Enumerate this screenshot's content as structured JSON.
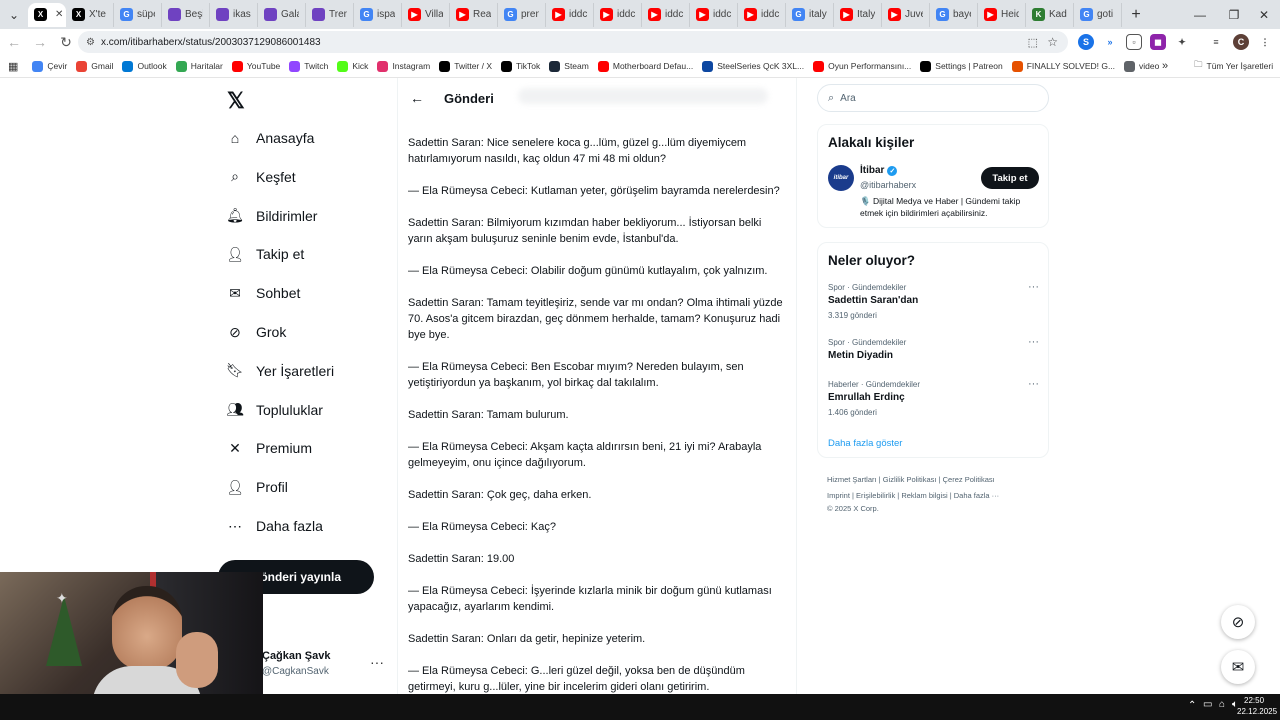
{
  "browser": {
    "tabs": [
      {
        "label": "X",
        "color": "#000000",
        "glyph": "X"
      },
      {
        "label": "X'te",
        "color": "#000000",
        "glyph": "X"
      },
      {
        "label": "süpe",
        "color": "#4285f4",
        "glyph": "G"
      },
      {
        "label": "Beşi",
        "color": "#6f42c1",
        "glyph": ""
      },
      {
        "label": "ikas",
        "color": "#6f42c1",
        "glyph": ""
      },
      {
        "label": "Gala",
        "color": "#6f42c1",
        "glyph": ""
      },
      {
        "label": "Trer",
        "color": "#6f42c1",
        "glyph": ""
      },
      {
        "label": "ispa",
        "color": "#4285f4",
        "glyph": "G"
      },
      {
        "label": "Villa",
        "color": "#ff0000",
        "glyph": "▶"
      },
      {
        "label": "Real",
        "color": "#ff0000",
        "glyph": "▶"
      },
      {
        "label": "pren",
        "color": "#4285f4",
        "glyph": "G"
      },
      {
        "label": "iddc",
        "color": "#ff0000",
        "glyph": "▶"
      },
      {
        "label": "iddc",
        "color": "#ff0000",
        "glyph": "▶"
      },
      {
        "label": "iddc",
        "color": "#ff0000",
        "glyph": "▶"
      },
      {
        "label": "iddc",
        "color": "#ff0000",
        "glyph": "▶"
      },
      {
        "label": "iddc",
        "color": "#ff0000",
        "glyph": "▶"
      },
      {
        "label": "italy",
        "color": "#4285f4",
        "glyph": "G"
      },
      {
        "label": "İtaly",
        "color": "#ff0000",
        "glyph": "▶"
      },
      {
        "label": "Juve",
        "color": "#ff0000",
        "glyph": "▶"
      },
      {
        "label": "baye",
        "color": "#4285f4",
        "glyph": "G"
      },
      {
        "label": "Heid",
        "color": "#ff0000",
        "glyph": "▶"
      },
      {
        "label": "Kadı",
        "color": "#2e7d32",
        "glyph": "K"
      },
      {
        "label": "goti",
        "color": "#4285f4",
        "glyph": "G"
      }
    ],
    "new_tab": "+",
    "url": "x.com/itibarhaberx/status/2003037129086001483",
    "profile_initial": "C",
    "bookmarks": [
      {
        "label": "Çevir",
        "color": "#4285f4"
      },
      {
        "label": "Gmail",
        "color": "#ea4335"
      },
      {
        "label": "Outlook",
        "color": "#0078d4"
      },
      {
        "label": "Haritalar",
        "color": "#34a853"
      },
      {
        "label": "YouTube",
        "color": "#ff0000"
      },
      {
        "label": "Twitch",
        "color": "#9146ff"
      },
      {
        "label": "Kick",
        "color": "#53fc18"
      },
      {
        "label": "Instagram",
        "color": "#e1306c"
      },
      {
        "label": "Twitter / X",
        "color": "#000000"
      },
      {
        "label": "TikTok",
        "color": "#000000"
      },
      {
        "label": "Steam",
        "color": "#1b2838"
      },
      {
        "label": "Motherboard Defau...",
        "color": "#ff0000"
      },
      {
        "label": "SteelSeries QcK 3XL...",
        "color": "#0d47a1"
      },
      {
        "label": "Oyun Performansını...",
        "color": "#ff0000"
      },
      {
        "label": "Settings | Patreon",
        "color": "#000000"
      },
      {
        "label": "FINALLY SOLVED! G...",
        "color": "#e65100"
      },
      {
        "label": "video",
        "color": "#5f6368"
      }
    ],
    "all_bookmarks": "Tüm Yer İşaretleri"
  },
  "sidebar": {
    "items": [
      {
        "label": "Anasayfa",
        "icon": "home-icon"
      },
      {
        "label": "Keşfet",
        "icon": "search-icon"
      },
      {
        "label": "Bildirimler",
        "icon": "bell-icon"
      },
      {
        "label": "Takip et",
        "icon": "add-user-icon"
      },
      {
        "label": "Sohbet",
        "icon": "mail-icon"
      },
      {
        "label": "Grok",
        "icon": "grok-icon"
      },
      {
        "label": "Yer İşaretleri",
        "icon": "bookmark-icon"
      },
      {
        "label": "Topluluklar",
        "icon": "communities-icon"
      },
      {
        "label": "Premium",
        "icon": "x-icon"
      },
      {
        "label": "Profil",
        "icon": "profile-icon"
      },
      {
        "label": "Daha fazla",
        "icon": "more-circle-icon"
      }
    ],
    "post_button": "Gönderi yayınla",
    "account": {
      "name": "Çağkan Şavk",
      "handle": "@CagkanSavk",
      "more": "···"
    }
  },
  "post": {
    "header_title": "Gönderi",
    "paragraphs": [
      "Sadettin Saran: Nice senelere koca g...lüm, güzel g...lüm diyemiycem hatırlamıyorum nasıldı, kaç oldun 47 mi 48 mi oldun?",
      "— Ela Rümeysa Cebeci: Kutlaman yeter, görüşelim bayramda nerelerdesin?",
      "Sadettin Saran: Bilmiyorum kızımdan haber bekliyorum... İstiyorsan belki yarın akşam buluşuruz seninle benim evde, İstanbul'da.",
      "— Ela Rümeysa Cebeci: Olabilir doğum günümü kutlayalım, çok yalnızım.",
      "Sadettin Saran: Tamam teyitleşiriz, sende var mı ondan? Olma ihtimali yüzde 70. Asos'a gitcem birazdan, geç dönmem herhalde, tamam? Konuşuruz hadi bye bye.",
      "— Ela Rümeysa Cebeci: Ben Escobar mıyım? Nereden bulayım, sen yetiştiriyordun ya başkanım, yol birkaç dal takılalım.",
      "Sadettin Saran: Tamam bulurum.",
      "— Ela Rümeysa Cebeci: Akşam kaçta aldırırsın beni, 21 iyi mi? Arabayla gelmeyeyim, onu içince dağılıyorum.",
      "Sadettin Saran: Çok geç, daha erken.",
      "— Ela Rümeysa Cebeci: Kaç?",
      "Sadettin Saran: 19.00",
      "— Ela Rümeysa Cebeci: İşyerinde kızlarla minik bir doğum günü kutlaması yapacağız, ayarlarım kendimi.",
      "Sadettin Saran: Onları da getir, hepinize yeterim.",
      "— Ela Rümeysa Cebeci: G...leri güzel değil, yoksa ben de düşündüm getirmeyi, kuru g...lüler, yine bir incelerim gideri olanı getiririm."
    ]
  },
  "right": {
    "search_placeholder": "Ara",
    "relevant": {
      "title": "Alakalı kişiler",
      "name": "İtibar",
      "handle": "@itibarhaberx",
      "avatar_text": "itibar",
      "bio": "🎙️ Dijital Medya ve Haber | Gündemi takip etmek için bildirimleri açabilirsiniz.",
      "follow": "Takip et"
    },
    "trends": {
      "title": "Neler oluyor?",
      "items": [
        {
          "category": "Spor · Gündemdekiler",
          "name": "Sadettin Saran'dan",
          "count": "3.319 gönderi"
        },
        {
          "category": "Spor · Gündemdekiler",
          "name": "Metin Diyadin",
          "count": ""
        },
        {
          "category": "Haberler · Gündemdekiler",
          "name": "Emrullah Erdinç",
          "count": "1.406 gönderi"
        }
      ],
      "show_more": "Daha fazla göster"
    },
    "footer": {
      "line1": [
        "Hizmet Şartları",
        "Gizlilik Politikası",
        "Çerez Politikası"
      ],
      "line2": [
        "Imprint",
        "Erişilebilirlik",
        "Reklam bilgisi",
        "Daha fazla ···"
      ],
      "copyright": "© 2025 X Corp."
    }
  },
  "taskbar": {
    "time": "22:50",
    "date": "22.12.2025"
  }
}
